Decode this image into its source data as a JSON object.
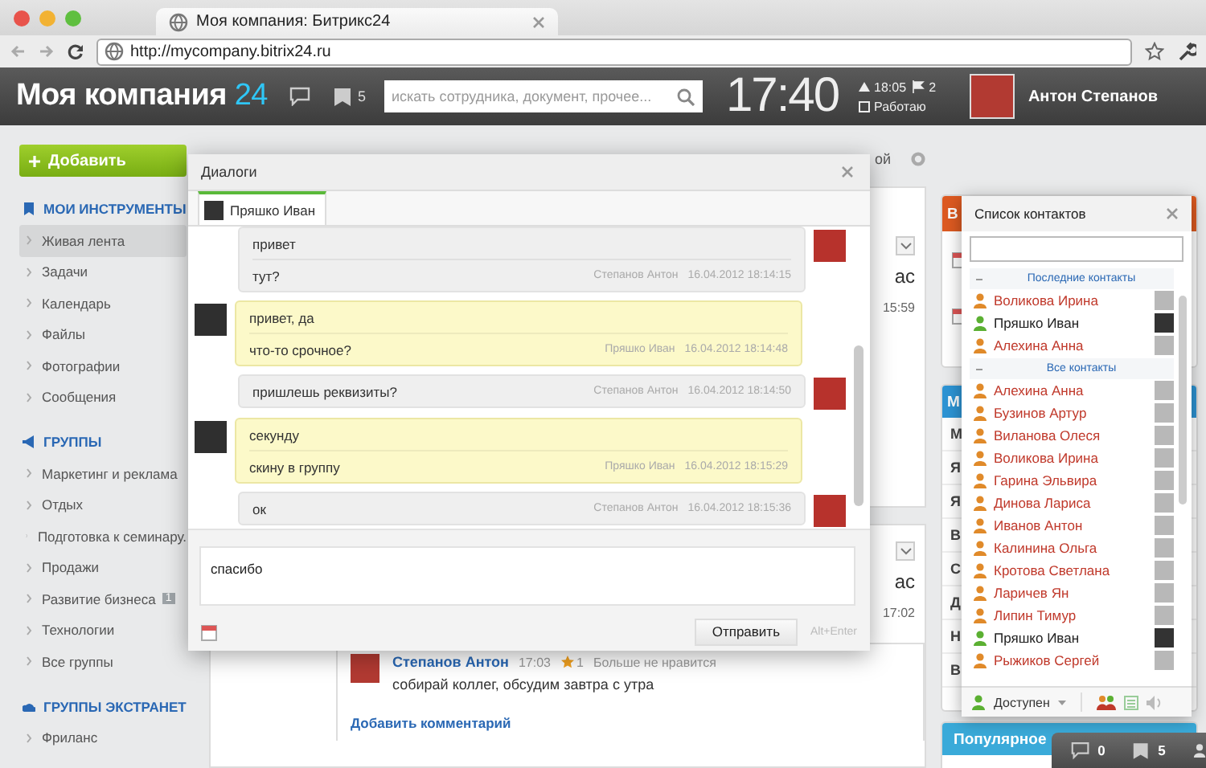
{
  "browser": {
    "tab_title": "Моя компания: Битрикс24",
    "url": "http://mycompany.bitrix24.ru"
  },
  "header": {
    "logo": "Моя компания",
    "logo_number": "24",
    "tasks_count": "5",
    "search": {
      "placeholder": "искать сотрудника, документ, прочее..."
    },
    "clock": "17:40",
    "work_start": "18:05",
    "flags_count": "2",
    "work_status": "Работаю",
    "user_name": "Антон Степанов"
  },
  "sidebar": {
    "add_button": "Добавить",
    "sections": [
      {
        "title": "МОИ ИНСТРУМЕНТЫ",
        "kind": "bookmark",
        "items": [
          {
            "label": "Живая лента",
            "selected": true
          },
          {
            "label": "Задачи",
            "selected": false
          },
          {
            "label": "Календарь",
            "selected": false
          },
          {
            "label": "Файлы",
            "selected": false
          },
          {
            "label": "Фотографии",
            "selected": false
          },
          {
            "label": "Сообщения",
            "selected": false
          }
        ]
      },
      {
        "title": "ГРУППЫ",
        "kind": "megaphone",
        "items": [
          {
            "label": "Маркетинг и реклама",
            "selected": false
          },
          {
            "label": "Отдых",
            "selected": false
          },
          {
            "label": "Подготовка к семинару.",
            "selected": false
          },
          {
            "label": "Продажи",
            "selected": false
          },
          {
            "label": "Развитие бизнеса",
            "selected": false,
            "badge": "1"
          },
          {
            "label": "Технологии",
            "selected": false
          },
          {
            "label": "Все группы",
            "selected": false
          }
        ]
      },
      {
        "title": "ГРУППЫ ЭКСТРАНЕТ",
        "kind": "cloud",
        "items": [
          {
            "label": "Фриланс",
            "selected": false
          }
        ]
      }
    ]
  },
  "feed": {
    "top_fragment": "ой",
    "posts": [
      {
        "fragment": "ас",
        "time": "15:59"
      },
      {
        "fragment": "ас",
        "time": "17:02",
        "comment": {
          "author": "Степанов Антон",
          "time": "17:03",
          "likes": "1",
          "like_label": "Больше не нравится",
          "text": "собирай коллег, обсудим завтра с утра"
        },
        "add_comment": "Добавить комментарий"
      }
    ]
  },
  "right_column": {
    "cards": [
      {
        "kind": "events",
        "title": "В",
        "color": "#dd5a21"
      },
      {
        "kind": "people",
        "title": "М",
        "color": "#2d94d4",
        "rows": [
          "М",
          "Я",
          "Я",
          "В",
          "С",
          "Д",
          "Н",
          "В"
        ]
      },
      {
        "kind": "popular",
        "title": "Популярное",
        "color": "#3aaad9"
      }
    ]
  },
  "dialog": {
    "title": "Диалоги",
    "tab": {
      "name": "Пряшко Иван",
      "selected": true
    },
    "messages": [
      {
        "kind": "outgoing",
        "lines": [
          "привет",
          "тут?"
        ],
        "author": "Степанов Антон",
        "time": "16.04.2012 18:14:15"
      },
      {
        "kind": "incoming",
        "lines": [
          "привет, да",
          "что-то срочное?"
        ],
        "author": "Пряшко Иван",
        "time": "16.04.2012 18:14:48"
      },
      {
        "kind": "outgoing",
        "lines": [
          "пришлешь реквизиты?"
        ],
        "author": "Степанов Антон",
        "time": "16.04.2012 18:14:50"
      },
      {
        "kind": "incoming",
        "lines": [
          "секунду",
          "скину в группу"
        ],
        "author": "Пряшко Иван",
        "time": "16.04.2012 18:15:29"
      },
      {
        "kind": "outgoing",
        "lines": [
          "ок"
        ],
        "author": "Степанов Антон",
        "time": "16.04.2012 18:15:36"
      }
    ],
    "input": {
      "value": "спасибо"
    },
    "send_button": "Отправить",
    "send_hint": "Alt+Enter"
  },
  "contacts": {
    "title": "Список контактов",
    "sections": [
      {
        "title": "Последние контакты",
        "contacts": [
          {
            "name": "Воликова Ирина",
            "online": false
          },
          {
            "name": "Пряшко Иван",
            "online": true
          },
          {
            "name": "Алехина Анна",
            "online": false
          }
        ]
      },
      {
        "title": "Все контакты",
        "contacts": [
          {
            "name": "Алехина Анна",
            "online": false
          },
          {
            "name": "Бузинов Артур",
            "online": false
          },
          {
            "name": "Виланова Олеся",
            "online": false
          },
          {
            "name": "Воликова Ирина",
            "online": false
          },
          {
            "name": "Гарина Эльвира",
            "online": false
          },
          {
            "name": "Динова Лариса",
            "online": false
          },
          {
            "name": "Иванов Антон",
            "online": false
          },
          {
            "name": "Калинина Ольга",
            "online": false
          },
          {
            "name": "Кротова Светлана",
            "online": false
          },
          {
            "name": "Ларичев Ян",
            "online": false
          },
          {
            "name": "Липин Тимур",
            "online": false
          },
          {
            "name": "Пряшко Иван",
            "online": true
          },
          {
            "name": "Рыжиков Сергей",
            "online": false
          }
        ]
      }
    ],
    "status": "Доступен"
  },
  "counters": {
    "messages": "0",
    "tasks": "5"
  }
}
